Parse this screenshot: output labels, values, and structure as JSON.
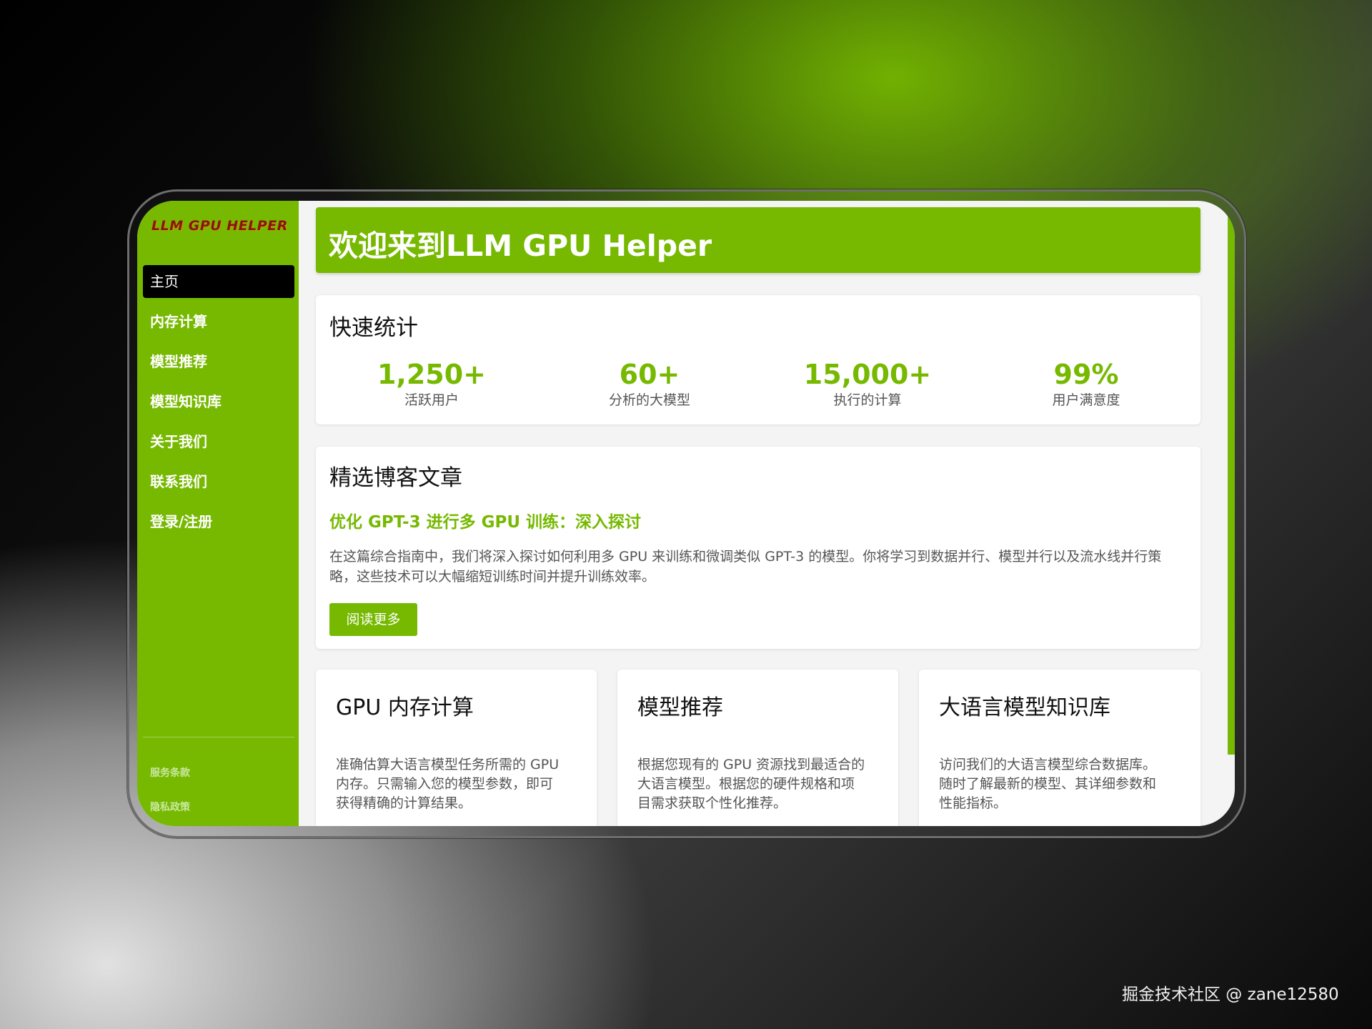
{
  "app": {
    "logo_text": "LLM GPU HELPER"
  },
  "sidebar": {
    "items": [
      {
        "label": "主页",
        "active": true
      },
      {
        "label": "内存计算"
      },
      {
        "label": "模型推荐"
      },
      {
        "label": "模型知识库"
      },
      {
        "label": "关于我们"
      },
      {
        "label": "联系我们"
      },
      {
        "label": "登录/注册"
      }
    ],
    "footer_links": [
      "服务条款",
      "隐私政策"
    ]
  },
  "banner": {
    "title": "欢迎来到LLM GPU Helper"
  },
  "stats": {
    "title": "快速统计",
    "items": [
      {
        "value": "1,250+",
        "label": "活跃用户"
      },
      {
        "value": "60+",
        "label": "分析的大模型"
      },
      {
        "value": "15,000+",
        "label": "执行的计算"
      },
      {
        "value": "99%",
        "label": "用户满意度"
      }
    ]
  },
  "blog": {
    "title": "精选博客文章",
    "article_title": "优化 GPT-3 进行多 GPU 训练：深入探讨",
    "excerpt": "在这篇综合指南中，我们将深入探讨如何利用多 GPU 来训练和微调类似 GPT-3 的模型。你将学习到数据并行、模型并行以及流水线并行策略，这些技术可以大幅缩短训练时间并提升训练效率。",
    "read_more": "阅读更多"
  },
  "features": [
    {
      "title": "GPU 内存计算",
      "description": "准确估算大语言模型任务所需的 GPU 内存。只需输入您的模型参数，即可获得精确的计算结果。"
    },
    {
      "title": "模型推荐",
      "description": "根据您现有的 GPU 资源找到最适合的大语言模型。根据您的硬件规格和项目需求获取个性化推荐。"
    },
    {
      "title": "大语言模型知识库",
      "description": "访问我们的大语言模型综合数据库。随时了解最新的模型、其详细参数和性能指标。"
    }
  ],
  "watermark": "掘金技术社区 @ zane12580",
  "colors": {
    "accent": "#76b900",
    "active_nav_bg": "#000000",
    "logo": "#8a1410"
  }
}
